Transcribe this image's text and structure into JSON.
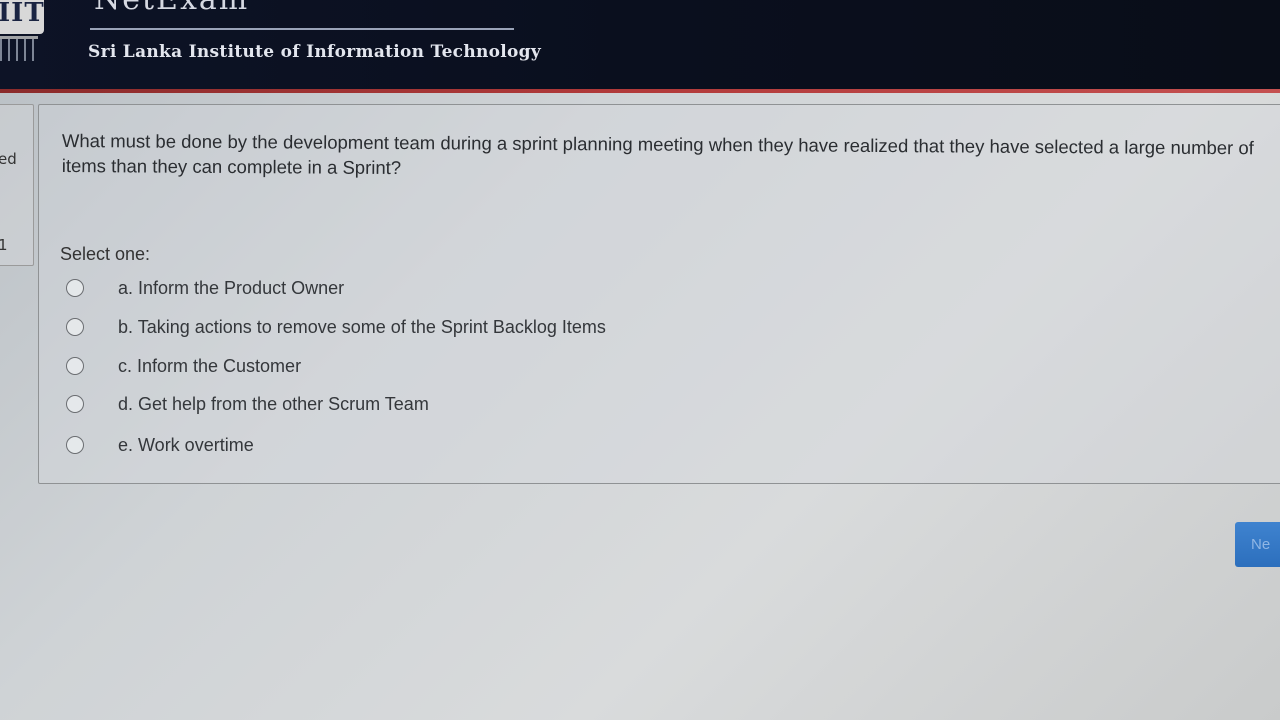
{
  "header": {
    "logo_text": "IIT",
    "brand_name": "NetExam",
    "institute_name": "Sri Lanka Institute of Information Technology"
  },
  "side_panel": {
    "text_1": "ed",
    "text_2": "1"
  },
  "question": {
    "text": "What must be done by the development team during a sprint planning meeting when they have realized that they have selected a large number of items than they can complete in a Sprint?",
    "prompt": "Select one:",
    "options": [
      {
        "label": "a. Inform the Product Owner",
        "selected": false
      },
      {
        "label": "b. Taking actions to remove some of the Sprint Backlog Items",
        "selected": false
      },
      {
        "label": "c. Inform the Customer",
        "selected": false
      },
      {
        "label": "d. Get help from the other Scrum Team",
        "selected": false
      },
      {
        "label": "e. Work overtime",
        "selected": false
      }
    ]
  },
  "navigation": {
    "next_label": "Ne"
  },
  "colors": {
    "header_bg": "#0a0f1e",
    "header_accent": "#b23a3a",
    "button_blue": "#3478c6"
  }
}
